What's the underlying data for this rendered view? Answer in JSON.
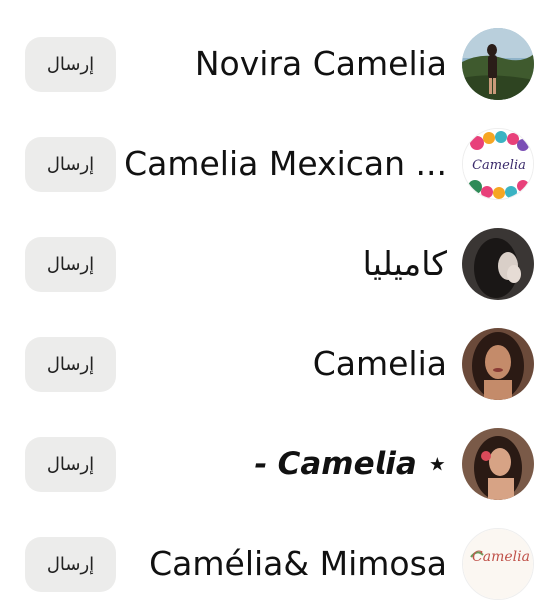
{
  "send_label": "إرسال",
  "accounts": [
    {
      "name": "Novira Camelia",
      "avatar": "woman-lake-photo-avatar"
    },
    {
      "name": "Camelia Mexican ...",
      "avatar": "camelia-flower-logo-avatar"
    },
    {
      "name": "كاميليا",
      "avatar": "dark-hair-selfie-avatar"
    },
    {
      "name": "Camelia",
      "avatar": "woman-portrait-avatar"
    },
    {
      "name": "- 𝘾𝙖𝙢𝙚𝙡𝙞𝙖 ⋆",
      "avatar": "woman-flower-avatar"
    },
    {
      "name": "Camélia& Mimosa",
      "avatar": "camelia-script-logo-avatar"
    }
  ],
  "logos": {
    "camelia_mexican_text": "Camelia",
    "camelia_mimosa_text": "Camelia"
  }
}
